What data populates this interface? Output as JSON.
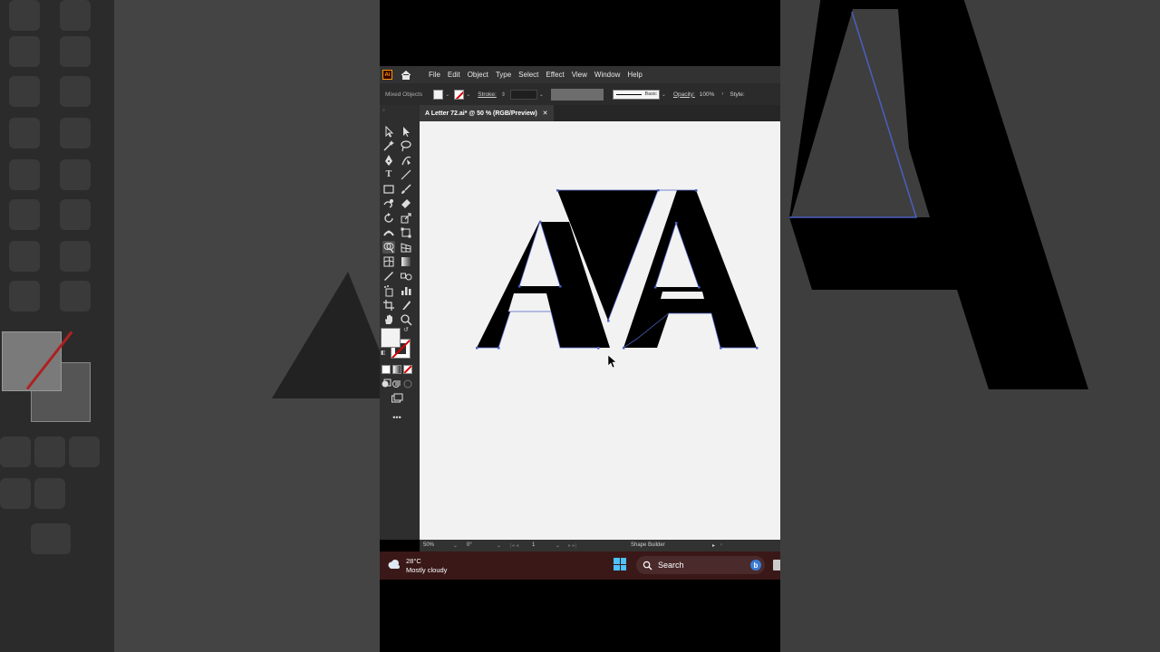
{
  "app": {
    "logo_text": "Ai",
    "menus": [
      "File",
      "Edit",
      "Object",
      "Type",
      "Select",
      "Effect",
      "View",
      "Window",
      "Help"
    ]
  },
  "control_bar": {
    "selection_label": "Mixed Objects",
    "stroke_label": "Stroke:",
    "stroke_style": "Basic",
    "opacity_label": "Opacity:",
    "opacity_value": "100%",
    "style_label": "Style:"
  },
  "document": {
    "tab_title": "A Letter 72.ai* @ 50 % (RGB/Preview)",
    "close_glyph": "✕"
  },
  "statusbar": {
    "zoom": "50%",
    "rotation": "0°",
    "artboard": "1",
    "tool_name": "Shape Builder"
  },
  "taskbar": {
    "temperature": "28°C",
    "weather": "Mostly cloudy",
    "search_label": "Search",
    "bing_label": "b"
  },
  "colors": {
    "accent_selection": "#4a5fc1",
    "taskbar": "#3a1818",
    "none_swatch": "#dd0000"
  }
}
